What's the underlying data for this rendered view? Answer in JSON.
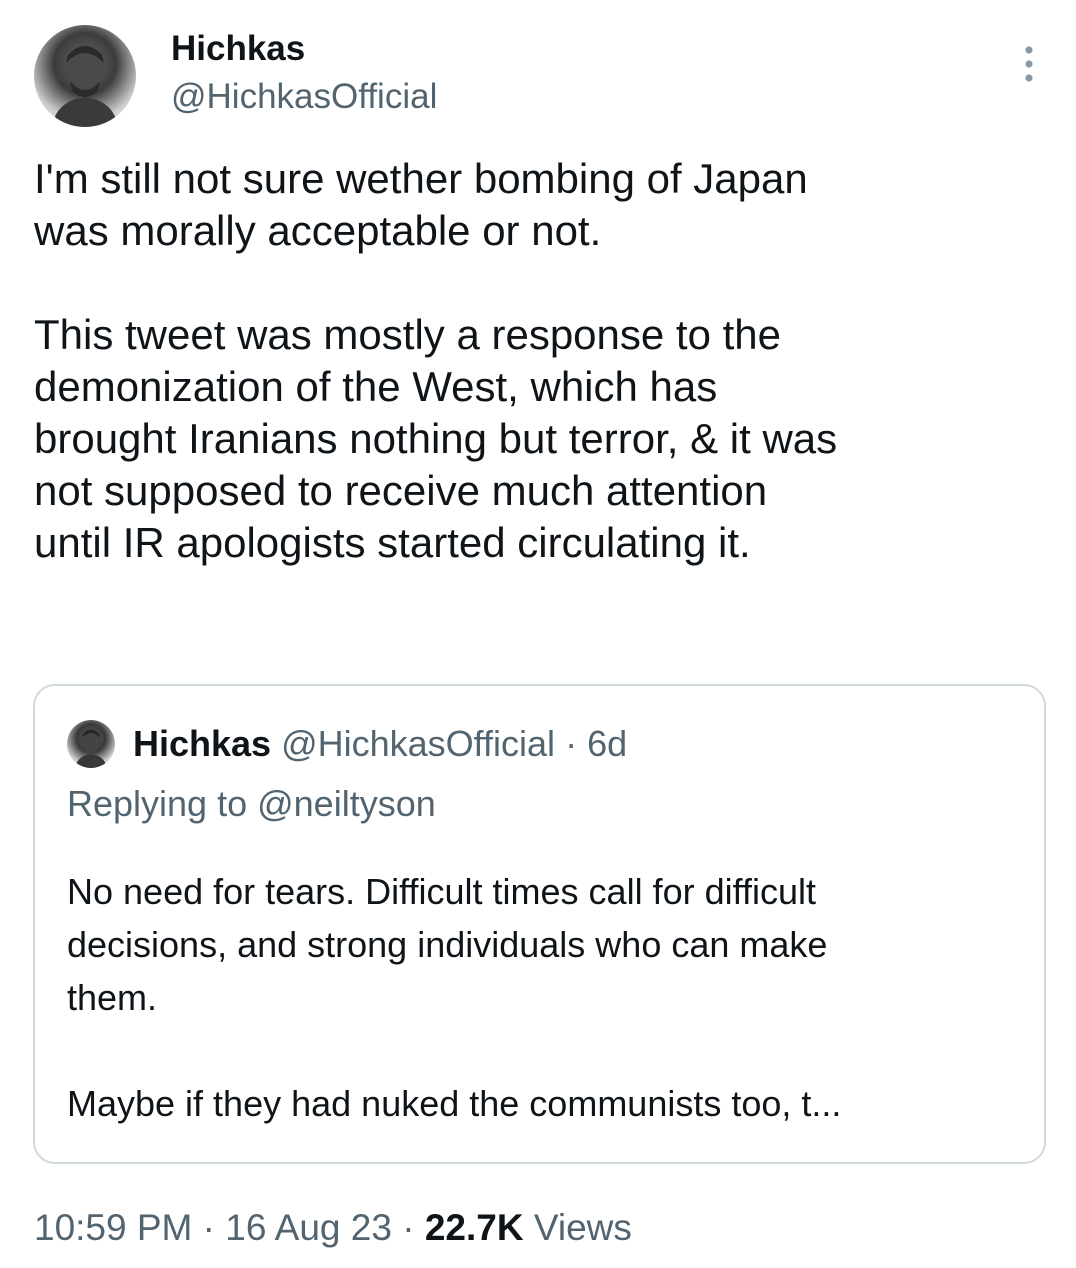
{
  "author": {
    "display_name": "Hichkas",
    "handle": "@HichkasOfficial",
    "avatar_icon": "profile-photo"
  },
  "more_icon": "more-vertical-icon",
  "tweet": {
    "text": "I'm still not sure wether bombing of Japan\nwas morally acceptable or not.\n\nThis tweet was mostly a response to the\ndemonization of the West, which has\nbrought Iranians nothing but terror, & it was\nnot supposed to receive much attention\nuntil IR apologists started circulating it."
  },
  "quoted_tweet": {
    "display_name": "Hichkas",
    "handle": "@HichkasOfficial",
    "separator": "·",
    "time": "6d",
    "replying_to": "Replying to @neiltyson",
    "text": "No need for tears. Difficult times call for difficult\ndecisions, and strong individuals who can make\nthem.\n\nMaybe if they had nuked the communists too, t..."
  },
  "meta": {
    "time": "10:59 PM",
    "sep1": "·",
    "date": "16 Aug 23",
    "sep2": "·",
    "views_count": "22.7K",
    "views_label": "Views"
  },
  "colors": {
    "text_primary": "#0f1419",
    "text_secondary": "#536471",
    "border": "#cfd9de"
  }
}
